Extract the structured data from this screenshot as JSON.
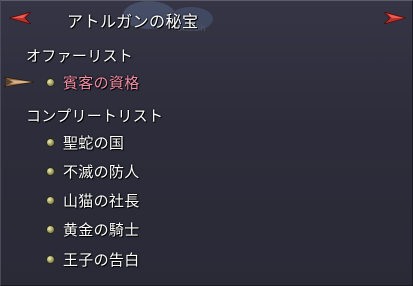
{
  "window": {
    "title": "アトルガンの秘宝",
    "title_bg_glyphs": "9m  5h"
  },
  "sections": [
    {
      "header": "オファーリスト",
      "items": [
        {
          "label": "賓客の資格",
          "selected": true
        }
      ]
    },
    {
      "header": "コンプリートリスト",
      "items": [
        {
          "label": "聖蛇の国",
          "selected": false
        },
        {
          "label": "不滅の防人",
          "selected": false
        },
        {
          "label": "山猫の社長",
          "selected": false
        },
        {
          "label": "黄金の騎士",
          "selected": false
        },
        {
          "label": "王子の告白",
          "selected": false
        }
      ]
    }
  ],
  "colors": {
    "selected_text": "#f08ca5",
    "normal_text": "#ffffff",
    "arrow_red": "#c0302a",
    "panel": "#2c2c3a"
  },
  "icons": {
    "title_left": "left-arrow-icon",
    "title_right": "right-arrow-icon",
    "cursor": "pointer-hand-cursor-icon",
    "bullet": "orb-bullet-icon"
  }
}
